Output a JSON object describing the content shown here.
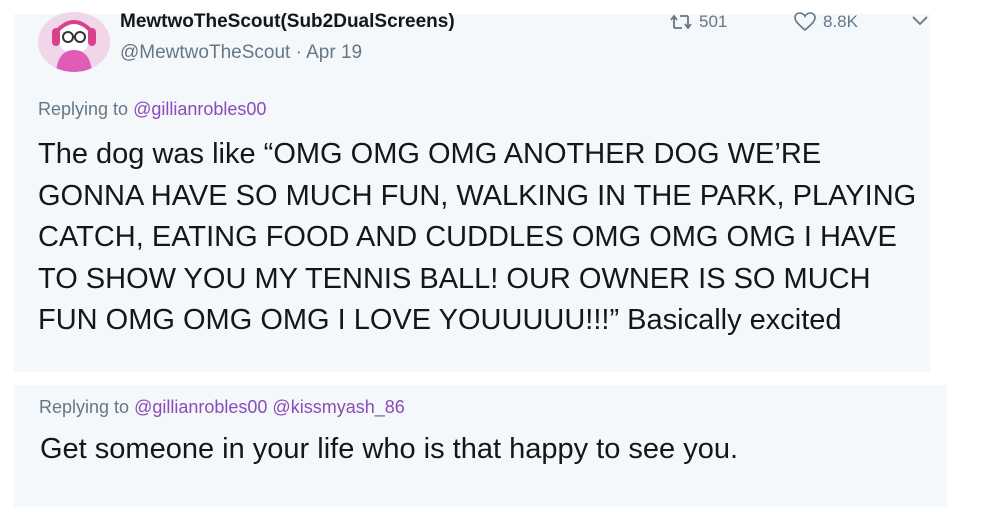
{
  "tweet": {
    "display_name": "MewtwoTheScout(Sub2DualScreens)",
    "handle_date": "@MewtwoTheScout · Apr 19",
    "retweets": "501",
    "likes": "8.8K",
    "replying_prefix": "Replying to",
    "replying_mention": "@gillianrobles00",
    "text": "The dog was like “OMG OMG OMG ANOTHER DOG WE’RE GONNA HAVE SO MUCH FUN, WALKING IN THE PARK, PLAYING CATCH, EATING FOOD AND CUDDLES OMG OMG OMG I HAVE TO SHOW YOU MY TENNIS BALL! OUR OWNER IS SO MUCH FUN OMG OMG OMG I LOVE YOUUUUU!!!” Basically excited"
  },
  "reply": {
    "replying_prefix": "Replying to",
    "replying_mentions": "@gillianrobles00 @kissmyash_86",
    "text": "Get someone in your life who is that happy to see you."
  },
  "icons": [
    "avatar-image",
    "retweet-icon",
    "heart-icon",
    "chevron-down-icon"
  ],
  "colors": {
    "mention": "#8a4cb8",
    "meta": "#657786",
    "text": "#14171a",
    "panel": "#f5f8fa"
  }
}
